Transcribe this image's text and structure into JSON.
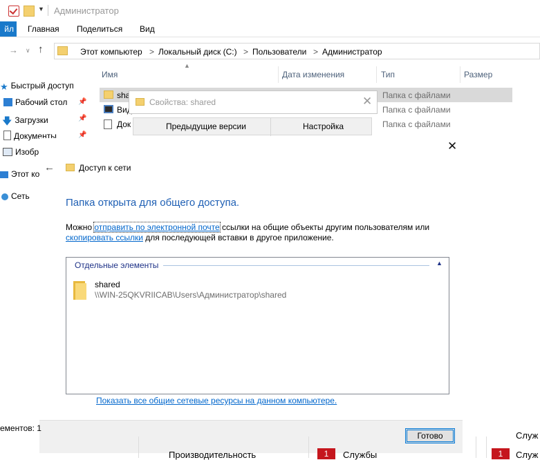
{
  "explorer": {
    "window_title": "Администратор",
    "ribbon": {
      "file_tab": "йл",
      "tabs": [
        "Главная",
        "Поделиться",
        "Вид"
      ]
    },
    "address": {
      "crumbs": [
        "Этот компьютер",
        "Локальный диск (C:)",
        "Пользователи",
        "Администратор"
      ],
      "separator": ">"
    },
    "columns": [
      "Имя",
      "Дата изменения",
      "Тип",
      "Размер"
    ],
    "nav_items": [
      {
        "label": "Быстрый доступ",
        "icon": "star-icon"
      },
      {
        "label": "Рабочий стол",
        "icon": "desktop-icon"
      },
      {
        "label": "Загрузки",
        "icon": "download-icon"
      },
      {
        "label": "Документы",
        "icon": "documents-icon"
      },
      {
        "label": "Изобр",
        "icon": "pictures-icon"
      },
      {
        "label": "Этот ко",
        "icon": "computer-icon"
      },
      {
        "label": "Сеть",
        "icon": "network-icon"
      }
    ],
    "files": [
      {
        "name": "sha",
        "type": "Папка с файлами"
      },
      {
        "name": "Вид",
        "type": "Папка с файлами"
      },
      {
        "name": "Док",
        "type": "Папка с файлами"
      }
    ],
    "status_bar": "ементов: 1"
  },
  "properties_window": {
    "title": "Свойства: shared",
    "tabs": [
      "Предыдущие версии",
      "Настройка"
    ]
  },
  "dialog": {
    "header_title": "Доступ к сети",
    "heading": "Папка открыта для общего доступа.",
    "text_before": "Можно ",
    "link_email": "отправить по электронной почте",
    "text_middle": " ссылки на общие объекты другим пользователям или",
    "link_copy": "скопировать ссылки",
    "text_after": " для последующей вставки в другое приложение.",
    "group_label": "Отдельные элементы",
    "item": {
      "name": "shared",
      "path": "\\\\WIN-25QKVRIICAB\\Users\\Администратор\\shared"
    },
    "show_all_link": "Показать все общие сетевые ресурсы на данном компьютере.",
    "ok_button": "Готово"
  },
  "taskmgr_fragment": {
    "performance": "Производительность",
    "services": "Службы",
    "badge": "1",
    "right_top": "Служ",
    "right_bottom": "Служ"
  },
  "colors": {
    "accent": "#0078d7",
    "link": "#0066cc",
    "heading": "#1e5fb4",
    "folder": "#f4d06f"
  }
}
